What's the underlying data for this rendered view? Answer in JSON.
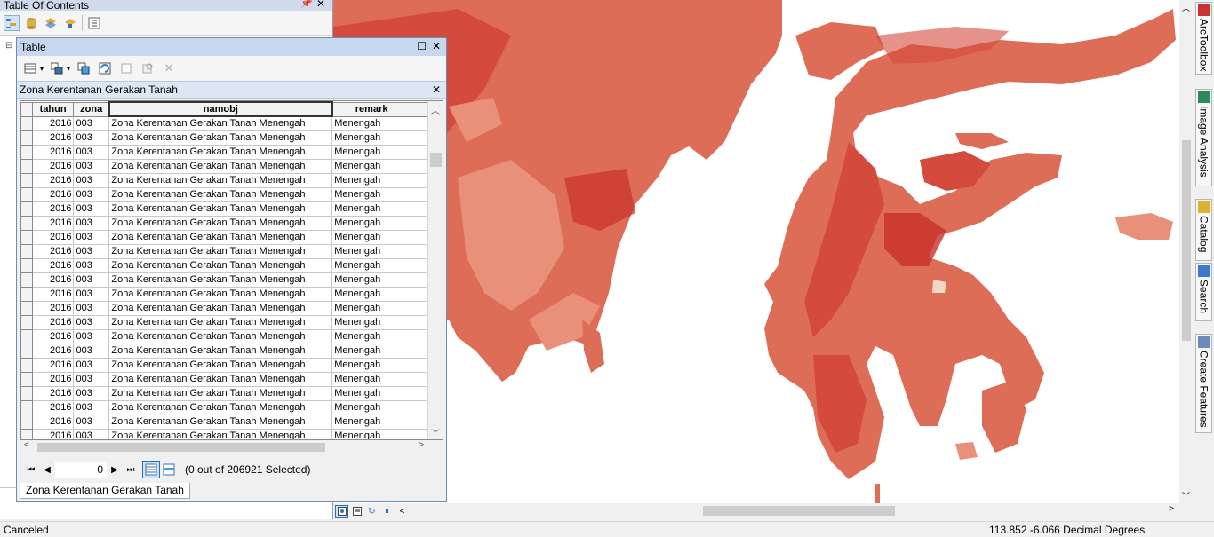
{
  "toc": {
    "title": "Table Of Contents",
    "pin_glyph": "📌",
    "close_glyph": "✕"
  },
  "table_window": {
    "title": "Table",
    "maximize_glyph": "☐",
    "close_glyph": "✕",
    "table_name": "Zona Kerentanan Gerakan Tanah",
    "columns": [
      "tahun",
      "zona",
      "namobj",
      "remark"
    ],
    "rows": [
      [
        "2016",
        "003",
        "Zona Kerentanan Gerakan Tanah Menengah",
        "Menengah"
      ],
      [
        "2016",
        "003",
        "Zona Kerentanan Gerakan Tanah Menengah",
        "Menengah"
      ],
      [
        "2016",
        "003",
        "Zona Kerentanan Gerakan Tanah Menengah",
        "Menengah"
      ],
      [
        "2016",
        "003",
        "Zona Kerentanan Gerakan Tanah Menengah",
        "Menengah"
      ],
      [
        "2016",
        "003",
        "Zona Kerentanan Gerakan Tanah Menengah",
        "Menengah"
      ],
      [
        "2016",
        "003",
        "Zona Kerentanan Gerakan Tanah Menengah",
        "Menengah"
      ],
      [
        "2016",
        "003",
        "Zona Kerentanan Gerakan Tanah Menengah",
        "Menengah"
      ],
      [
        "2016",
        "003",
        "Zona Kerentanan Gerakan Tanah Menengah",
        "Menengah"
      ],
      [
        "2016",
        "003",
        "Zona Kerentanan Gerakan Tanah Menengah",
        "Menengah"
      ],
      [
        "2016",
        "003",
        "Zona Kerentanan Gerakan Tanah Menengah",
        "Menengah"
      ],
      [
        "2016",
        "003",
        "Zona Kerentanan Gerakan Tanah Menengah",
        "Menengah"
      ],
      [
        "2016",
        "003",
        "Zona Kerentanan Gerakan Tanah Menengah",
        "Menengah"
      ],
      [
        "2016",
        "003",
        "Zona Kerentanan Gerakan Tanah Menengah",
        "Menengah"
      ],
      [
        "2016",
        "003",
        "Zona Kerentanan Gerakan Tanah Menengah",
        "Menengah"
      ],
      [
        "2016",
        "003",
        "Zona Kerentanan Gerakan Tanah Menengah",
        "Menengah"
      ],
      [
        "2016",
        "003",
        "Zona Kerentanan Gerakan Tanah Menengah",
        "Menengah"
      ],
      [
        "2016",
        "003",
        "Zona Kerentanan Gerakan Tanah Menengah",
        "Menengah"
      ],
      [
        "2016",
        "003",
        "Zona Kerentanan Gerakan Tanah Menengah",
        "Menengah"
      ],
      [
        "2016",
        "003",
        "Zona Kerentanan Gerakan Tanah Menengah",
        "Menengah"
      ],
      [
        "2016",
        "003",
        "Zona Kerentanan Gerakan Tanah Menengah",
        "Menengah"
      ],
      [
        "2016",
        "003",
        "Zona Kerentanan Gerakan Tanah Menengah",
        "Menengah"
      ],
      [
        "2016",
        "003",
        "Zona Kerentanan Gerakan Tanah Menengah",
        "Menengah"
      ],
      [
        "2016",
        "003",
        "Zona Kerentanan Gerakan Tanah Menengah",
        "Menengah"
      ]
    ],
    "current_record": "0",
    "selection_text": "(0 out of 206921 Selected)",
    "bottom_tab": "Zona Kerentanan Gerakan Tanah"
  },
  "dock": {
    "tabs": [
      "ArcToolbox",
      "Image Analysis",
      "Catalog",
      "Search",
      "Create Features"
    ]
  },
  "map_colors": {
    "light": "#e8907a",
    "medium": "#de6d57",
    "dark": "#d44a3c",
    "darkest": "#c8302a"
  },
  "status": {
    "message": "Canceled",
    "coordinates": "113.852  -6.066 Decimal Degrees"
  }
}
